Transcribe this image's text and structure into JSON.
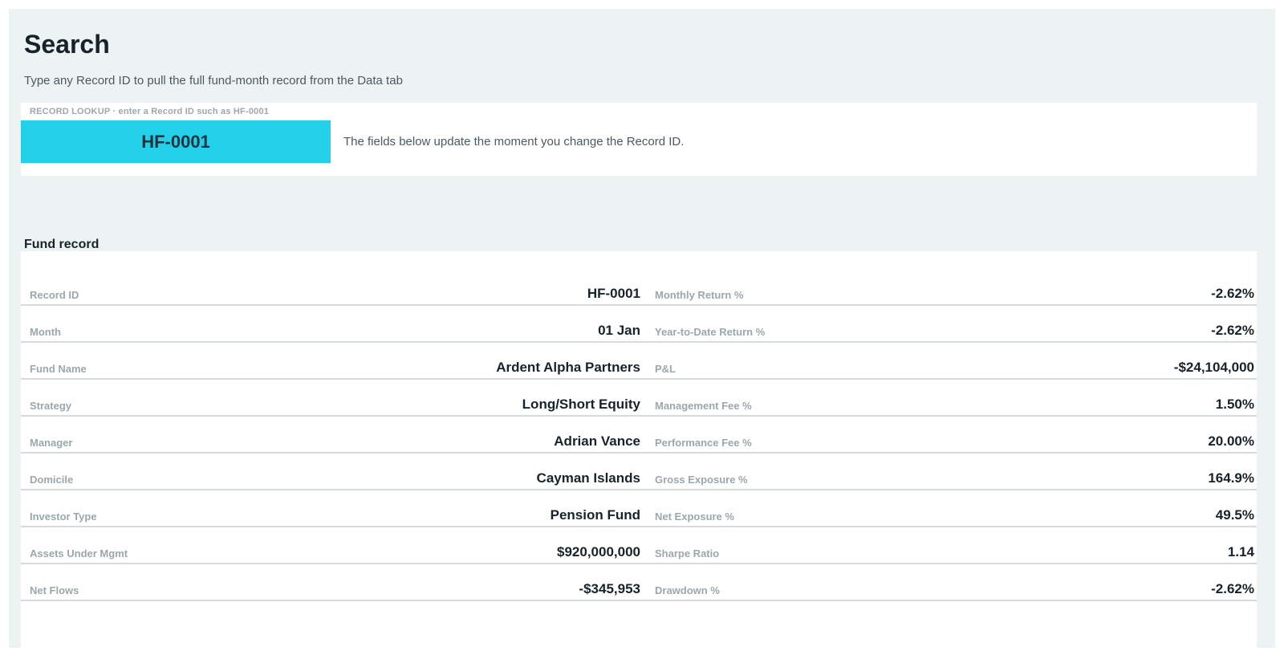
{
  "page": {
    "title": "Search",
    "subtitle": "Type any Record ID to pull the full fund-month record from the Data tab"
  },
  "lookup": {
    "label": "RECORD LOOKUP · enter a Record ID such as HF-0001",
    "value": "HF-0001",
    "note": "The fields below update the moment you change the Record ID."
  },
  "record": {
    "title": "Fund record",
    "rows": [
      {
        "left_label": "Record ID",
        "left_value": "HF-0001",
        "right_label": "Monthly Return %",
        "right_value": "-2.62%"
      },
      {
        "left_label": "Month",
        "left_value": "01 Jan",
        "right_label": "Year-to-Date Return %",
        "right_value": "-2.62%"
      },
      {
        "left_label": "Fund Name",
        "left_value": "Ardent Alpha Partners",
        "right_label": "P&L",
        "right_value": "-$24,104,000"
      },
      {
        "left_label": "Strategy",
        "left_value": "Long/Short Equity",
        "right_label": "Management Fee %",
        "right_value": "1.50%"
      },
      {
        "left_label": "Manager",
        "left_value": "Adrian Vance",
        "right_label": "Performance Fee %",
        "right_value": "20.00%"
      },
      {
        "left_label": "Domicile",
        "left_value": "Cayman Islands",
        "right_label": "Gross Exposure %",
        "right_value": "164.9%"
      },
      {
        "left_label": "Investor Type",
        "left_value": "Pension Fund",
        "right_label": "Net Exposure %",
        "right_value": "49.5%"
      },
      {
        "left_label": "Assets Under Mgmt",
        "left_value": "$920,000,000",
        "right_label": "Sharpe Ratio",
        "right_value": "1.14"
      },
      {
        "left_label": "Net Flows",
        "left_value": "-$345,953",
        "right_label": "Drawdown %",
        "right_value": "-2.62%"
      }
    ]
  },
  "colors": {
    "background": "#edf2f2",
    "accent_input": "#22d0ea",
    "label": "#9aa8ad",
    "text": "#17232b"
  }
}
